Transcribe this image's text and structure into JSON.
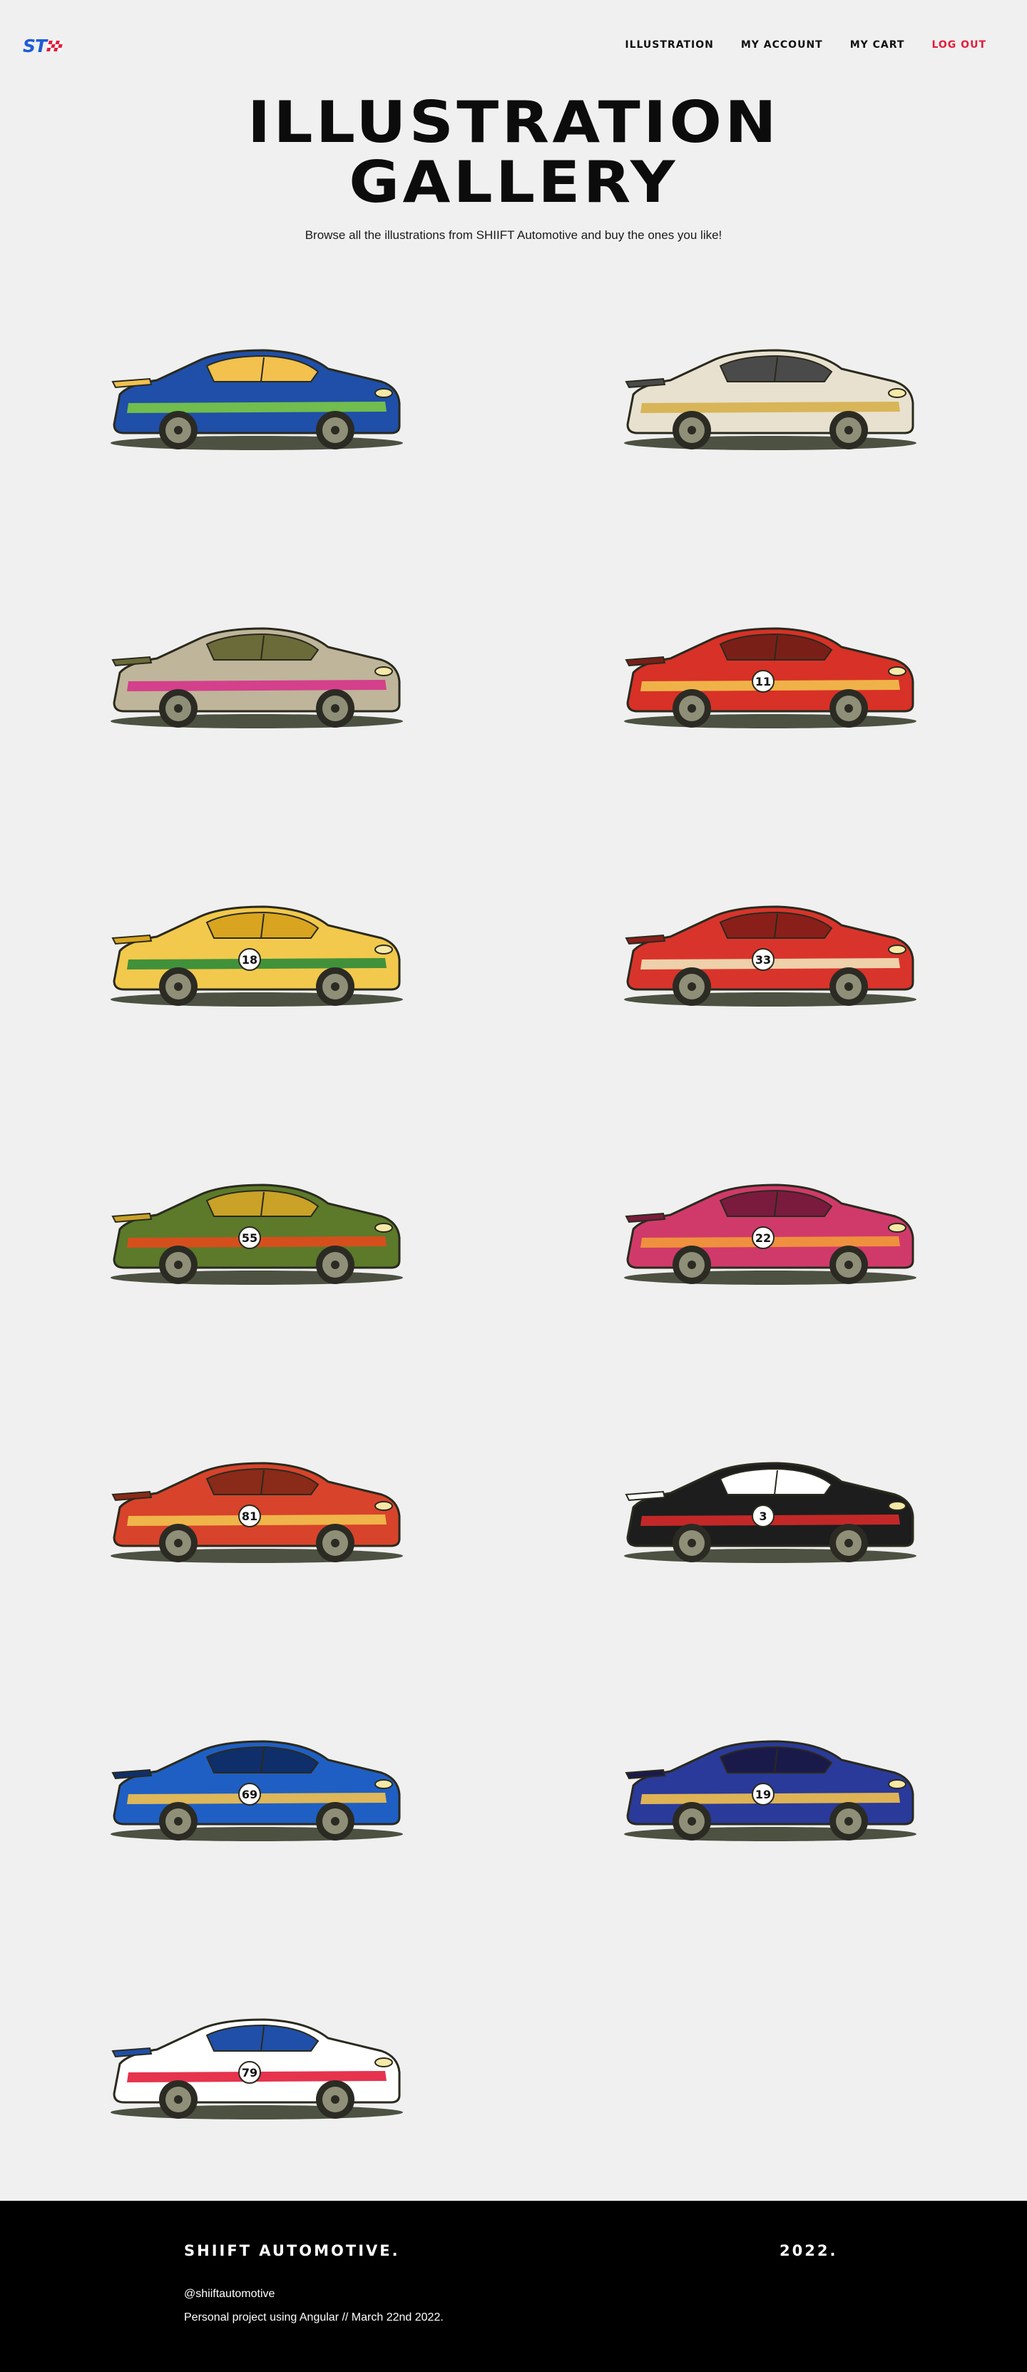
{
  "header": {
    "logo_text": "ST",
    "nav": [
      {
        "label": "ILLUSTRATION"
      },
      {
        "label": "MY ACCOUNT"
      },
      {
        "label": "MY CART"
      },
      {
        "label": "LOG OUT"
      }
    ]
  },
  "hero": {
    "title_line1": "ILLUSTRATION",
    "title_line2": "GALLERY",
    "subtitle": "Browse all the illustrations from SHIIFT Automotive and buy the ones you like!"
  },
  "colors": {
    "accent_red": "#e31d3b",
    "logo_blue": "#1d5bd8",
    "background": "#f0f0f0",
    "footer_bg": "#000000"
  },
  "gallery": {
    "cars": [
      {
        "icon": "rally-car-blue-icon",
        "body": "#1f4fa8",
        "accent": "#7ac943",
        "roof": "#f2c14e",
        "number": ""
      },
      {
        "icon": "gt-car-white-icon",
        "body": "#e8e1cf",
        "accent": "#d6b04a",
        "roof": "#4a4a4a",
        "number": ""
      },
      {
        "icon": "touring-car-silver-icon",
        "body": "#bfb59a",
        "accent": "#d6338a",
        "roof": "#6b6b3a",
        "number": ""
      },
      {
        "icon": "gt-car-red-icon",
        "body": "#d83127",
        "accent": "#f2c14e",
        "roof": "#7a1f18",
        "number": "11"
      },
      {
        "icon": "gt-car-yellow-icon",
        "body": "#f2c94c",
        "accent": "#2e8b3a",
        "roof": "#d9a520",
        "number": "18"
      },
      {
        "icon": "gt-car-red-stripe-icon",
        "body": "#d9342b",
        "accent": "#efe1b8",
        "roof": "#8a1f1a",
        "number": "33"
      },
      {
        "icon": "prototype-car-green-icon",
        "body": "#5c7a2a",
        "accent": "#e24a1c",
        "roof": "#c9a227",
        "number": "55"
      },
      {
        "icon": "gt-car-pink-icon",
        "body": "#d03a6a",
        "accent": "#f29a3a",
        "roof": "#7a1b3d",
        "number": "22"
      },
      {
        "icon": "gt-car-red-orange-icon",
        "body": "#d8432b",
        "accent": "#f2c14e",
        "roof": "#8a2a18",
        "number": "81"
      },
      {
        "icon": "gt-car-black-red-icon",
        "body": "#1d1d1d",
        "accent": "#d62a2a",
        "roof": "#ffffff",
        "number": "3"
      },
      {
        "icon": "gt-car-blue-livery-icon",
        "body": "#1f5fc4",
        "accent": "#f2c14e",
        "roof": "#0f2f6b",
        "number": "69"
      },
      {
        "icon": "gt-car-yellow-blue-icon",
        "body": "#2a3a9a",
        "accent": "#f2c14e",
        "roof": "#1a1a4a",
        "number": "19"
      },
      {
        "icon": "art-car-multicolor-icon",
        "body": "#ffffff",
        "accent": "#e31d3b",
        "roof": "#1f4fa8",
        "number": "79"
      }
    ]
  },
  "footer": {
    "brand": "SHIIFT AUTOMOTIVE.",
    "year": "2022.",
    "handle": "@shiiftautomotive",
    "note": "Personal project using Angular // March 22nd 2022."
  }
}
